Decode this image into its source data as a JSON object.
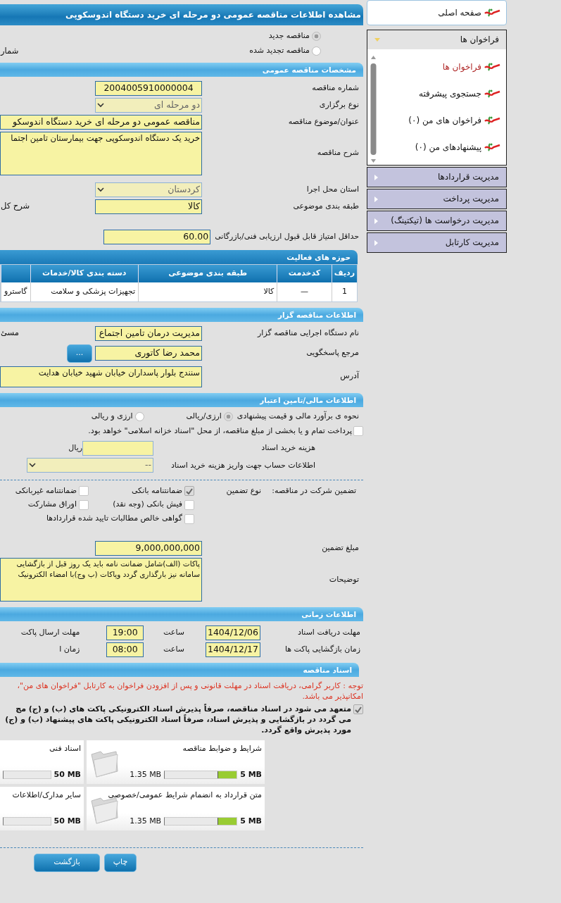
{
  "title": "مشاهده اطلاعات مناقصه عمومی دو مرحله ای خرید دستگاه اندوسکوپی",
  "tender_kind": {
    "options": [
      {
        "label": "مناقصه جدید",
        "selected": true
      },
      {
        "label": "مناقصه تجدید شده",
        "selected": false
      }
    ],
    "side_label": "شمار"
  },
  "general": {
    "title": "مشخصات مناقصه عمومی",
    "fields": [
      {
        "kind": "code",
        "label": "شماره مناقصه",
        "value": "2004005910000004"
      },
      {
        "kind": "select",
        "label": "نوع برگزاری",
        "value": "دو مرحله ای"
      },
      {
        "kind": "line",
        "label": "عنوان/موضوع مناقصه",
        "value": "مناقصه عمومی دو مرحله ای خرید دستگاه اندوسکو"
      },
      {
        "kind": "area",
        "label": "شرح مناقصه",
        "value": "خرید یک دستگاه اندوسکوپی جهت بیمارستان تامین اجتما"
      },
      {
        "kind": "select",
        "label": "استان محل اجرا",
        "value": "کردستان"
      },
      {
        "kind": "short",
        "label": "طبقه بندی موضوعی",
        "value": "کالا",
        "side_label": "شرح کل"
      },
      {
        "kind": "score",
        "label": "حداقل امتیاز قابل قبول ارزیابی فنی/بازرگانی",
        "value": "60.00"
      }
    ]
  },
  "activities": {
    "title": "حوزه های فعالیت",
    "columns": [
      "ردیف",
      "کدخدمت",
      "طبقه بندی موضوعی",
      "دسته بندی کالا/خدمات"
    ],
    "rows": [
      [
        "1",
        "—",
        "کالا",
        "تجهیزات پزشکی و سلامت",
        "گاسترو"
      ]
    ]
  },
  "organizer": {
    "title": "اطلاعات مناقصه گزار",
    "fields": [
      {
        "kind": "short",
        "label": "نام دستگاه اجرایی مناقصه گزار",
        "value": "مدیریت درمان تامین اجتماع",
        "side_label": "مسئ"
      },
      {
        "kind": "picker",
        "label": "مرجع پاسخگویی",
        "value": "محمد رضا کاتوری",
        "button": "..."
      },
      {
        "kind": "area",
        "label": "آدرس",
        "value": "سنندج بلوار پاسداران خیابان شهید خیابان هدایت"
      }
    ]
  },
  "finance": {
    "title": "اطلاعات مالی/تامین اعتبار",
    "estimate": {
      "label": "نحوه ی برآورد مالی و قیمت پیشنهادی",
      "options": [
        {
          "label": "ارزی/ریالی",
          "selected": true
        },
        {
          "label": "ارزی و ریالی",
          "selected": false
        }
      ]
    },
    "treasury": {
      "label": "پرداخت تمام و یا بخشی از مبلغ مناقصه، از محل \"اسناد خزانه اسلامی\" خواهد بود.",
      "checked": false
    },
    "fee": {
      "label": "هزینه خرید اسناد",
      "unit": "ریال"
    },
    "account": {
      "label": "اطلاعات حساب جهت واریز هزینه خرید اسناد",
      "value": "--"
    }
  },
  "guarantee": {
    "title": "تضمین شرکت در مناقصه:",
    "type_label": "نوع تضمین",
    "options": [
      {
        "label": "ضمانتنامه بانکی",
        "checked": true
      },
      {
        "label": "ضمانتنامه غیربانکی",
        "checked": false
      },
      {
        "label": "فیش بانکی (وجه نقد)",
        "checked": false
      },
      {
        "label": "اوراق مشارکت",
        "checked": false
      },
      {
        "label": "گواهی خالص مطالبات تایید شده قراردادها",
        "checked": false
      }
    ],
    "amount": {
      "label": "مبلغ تضمین",
      "value": "9,000,000,000"
    },
    "notes": {
      "label": "توضیحات",
      "value": "پاکات (الف)شامل ضمانت نامه باید یک روز قبل از بازگشایی\nسامانه نیز بارگذاری گردد وپاکات (ب وج)با امضاء الکترونیک"
    }
  },
  "timing": {
    "title": "اطلاعات زمانی",
    "rows": [
      {
        "label": "مهلت دریافت اسناد",
        "date": "1404/12/06",
        "time_label": "ساعت",
        "time": "19:00",
        "side_label": "مهلت ارسال پاکت"
      },
      {
        "label": "زمان بازگشایی پاکت ها",
        "date": "1404/12/17",
        "time_label": "ساعت",
        "time": "08:00",
        "side_label": "زمان ا"
      }
    ]
  },
  "documents": {
    "title": "اسناد مناقصه",
    "notice": "توجه : کاربر گرامی، دریافت اسناد در مهلت قانونی و پس از افزودن فراخوان به کارتابل \"فراخوان های من\"،\nامکانپذیر می باشد.",
    "commitment": {
      "text": "متعهد می شود در اسناد مناقصه، صرفاً پذیرش اسناد الکترونیکی پاکت های (ب) و (ج) مج\nمی گردد در بازگشایی و پذیرش اسناد، صرفاً اسناد الکترونیکی پاکت های پیشنهاد (ب) و (ج)\nمورد پذیرش واقع گردد.",
      "checked": true
    },
    "files": [
      {
        "name": "شرایط و ضوابط مناقصه",
        "max": "5 MB",
        "used": "1.35 MB",
        "level": 0.27
      },
      {
        "name": "اسناد فنی",
        "max": "50 MB",
        "level": 0
      },
      {
        "name": "متن قرارداد به انضمام شرایط عمومی/خصوصی",
        "max": "5 MB",
        "used": "1.35 MB",
        "level": 0.27
      },
      {
        "name": "سایر مدارک/اطلاعات",
        "max": "50 MB",
        "level": 0
      }
    ]
  },
  "buttons": [
    "چاپ",
    "بازگشت"
  ],
  "sidebar": {
    "home": "صفحه اصلی",
    "groups": [
      {
        "label": "فراخوان ها",
        "expanded": true,
        "items": [
          {
            "label": "فراخوان ها",
            "selected": true
          },
          {
            "label": "جستجوی پیشرفته",
            "selected": false
          },
          {
            "label": "فراخوان های من (۰)",
            "selected": false
          },
          {
            "label": "پیشنهادهای من  (۰)",
            "selected": false
          }
        ]
      },
      {
        "label": "مدیریت قراردادها",
        "expanded": false
      },
      {
        "label": "مدیریت پرداخت",
        "expanded": false
      },
      {
        "label": "مدیریت درخواست ها (تیکتینگ)",
        "expanded": false
      },
      {
        "label": "مدیریت کارتابل",
        "expanded": false
      }
    ]
  }
}
